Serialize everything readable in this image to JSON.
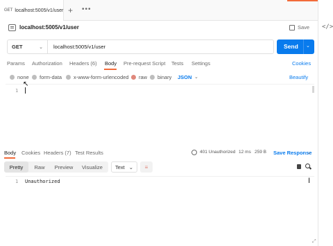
{
  "tab": {
    "method": "GET",
    "url": "localhost:5005/v1/user"
  },
  "header": {
    "name": "localhost:5005/v1/user",
    "save_label": "Save"
  },
  "request": {
    "method": "GET",
    "url": "localhost:5005/v1/user",
    "send_label": "Send",
    "tabs": [
      "Params",
      "Authorization",
      "Headers (6)",
      "Body",
      "Pre-request Script",
      "Tests",
      "Settings"
    ],
    "active_tab": "Body",
    "cookies_label": "Cookies",
    "body_types": [
      "none",
      "form-data",
      "x-www-form-urlencoded",
      "raw",
      "binary"
    ],
    "selected_body_type": "raw",
    "format": "JSON",
    "beautify_label": "Beautify",
    "editor_line": "1"
  },
  "response": {
    "tabs": [
      "Body",
      "Cookies",
      "Headers (7)",
      "Test Results"
    ],
    "active_tab": "Body",
    "status": "401 Unauthorized",
    "time": "12 ms",
    "size": "259 B",
    "save_label": "Save Response",
    "views": [
      "Pretty",
      "Raw",
      "Preview",
      "Visualize"
    ],
    "active_view": "Pretty",
    "type": "Text",
    "line": "1",
    "content": "Unauthorized"
  },
  "colors": {
    "accent": "#f26b3a",
    "send": "#097bed",
    "link": "#097bed"
  }
}
